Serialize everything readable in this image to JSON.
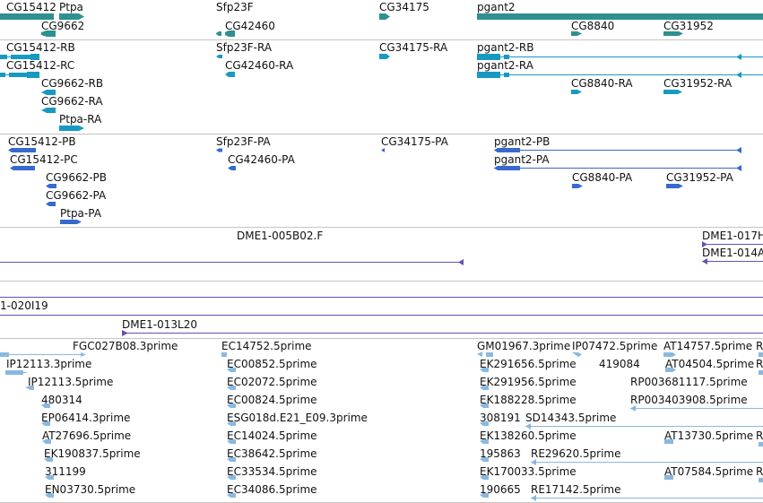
{
  "colors": {
    "gene": "#2e9091",
    "transcript": "#1899c1",
    "protein": "#3869cc",
    "clone": "#6a4fb0",
    "est": "#8ab8df",
    "separator": "#c4c4c4",
    "text": "#111111"
  },
  "tracks": {
    "genes": {
      "items": [
        {
          "label": "CG15412"
        },
        {
          "label": "Ptpa"
        },
        {
          "label": "CG9662"
        },
        {
          "label": "Sfp23F"
        },
        {
          "label": "CG42460"
        },
        {
          "label": "CG34175"
        },
        {
          "label": "pgant2"
        },
        {
          "label": "CG8840"
        },
        {
          "label": "CG31952"
        }
      ]
    },
    "transcripts": {
      "items": [
        {
          "label": "CG15412-RB"
        },
        {
          "label": "CG15412-RC"
        },
        {
          "label": "CG9662-RB"
        },
        {
          "label": "CG9662-RA"
        },
        {
          "label": "Ptpa-RA"
        },
        {
          "label": "Sfp23F-RA"
        },
        {
          "label": "CG42460-RA"
        },
        {
          "label": "CG34175-RA"
        },
        {
          "label": "pgant2-RB"
        },
        {
          "label": "pgant2-RA"
        },
        {
          "label": "CG8840-RA"
        },
        {
          "label": "CG31952-RA"
        }
      ]
    },
    "proteins": {
      "items": [
        {
          "label": "CG15412-PB"
        },
        {
          "label": "CG15412-PC"
        },
        {
          "label": "CG9662-PB"
        },
        {
          "label": "CG9662-PA"
        },
        {
          "label": "Ptpa-PA"
        },
        {
          "label": "Sfp23F-PA"
        },
        {
          "label": "CG42460-PA"
        },
        {
          "label": "CG34175-PA"
        },
        {
          "label": "pgant2-PB"
        },
        {
          "label": "pgant2-PA"
        },
        {
          "label": "CG8840-PA"
        },
        {
          "label": "CG31952-PA"
        }
      ]
    },
    "clones_a": {
      "items": [
        {
          "label": "DME1-005B02.F"
        },
        {
          "label": "DME1-017H"
        },
        {
          "label": "DME1-014A"
        }
      ]
    },
    "clones_b": {
      "items": [
        {
          "label": "1-020I19"
        },
        {
          "label": "DME1-013L20"
        }
      ]
    },
    "ests": {
      "items": [
        {
          "label": "FGC027B08.3prime"
        },
        {
          "label": "IP12113.3prime"
        },
        {
          "label": "IP12113.5prime"
        },
        {
          "label": "480314"
        },
        {
          "label": "EP06414.3prime"
        },
        {
          "label": "AT27696.5prime"
        },
        {
          "label": "EK190837.5prime"
        },
        {
          "label": "311199"
        },
        {
          "label": "EN03730.5prime"
        },
        {
          "label": "EC14752.5prime"
        },
        {
          "label": "EC00852.5prime"
        },
        {
          "label": "EC02072.5prime"
        },
        {
          "label": "EC00824.5prime"
        },
        {
          "label": "ESG018d.E21_E09.3prime"
        },
        {
          "label": "EC14024.5prime"
        },
        {
          "label": "EC38642.5prime"
        },
        {
          "label": "EC33534.5prime"
        },
        {
          "label": "EC34086.5prime"
        },
        {
          "label": "GM01967.3prime"
        },
        {
          "label": "IP07472.5prime"
        },
        {
          "label": "AT14757.5prime"
        },
        {
          "label": "R"
        },
        {
          "label": "EK291656.5prime"
        },
        {
          "label": "419084"
        },
        {
          "label": "AT04504.5prime"
        },
        {
          "label": "R"
        },
        {
          "label": "EK291956.5prime"
        },
        {
          "label": "RP003681117.5prime"
        },
        {
          "label": "EK188228.5prime"
        },
        {
          "label": "RP003403908.5prime"
        },
        {
          "label": "308191"
        },
        {
          "label": "SD14343.5prime"
        },
        {
          "label": "EK138260.5prime"
        },
        {
          "label": "AT13730.5prime"
        },
        {
          "label": "R"
        },
        {
          "label": "195863"
        },
        {
          "label": "RE29620.5prime"
        },
        {
          "label": "EK170033.5prime"
        },
        {
          "label": "AT07584.5prime"
        },
        {
          "label": "R"
        },
        {
          "label": "190665"
        },
        {
          "label": "RE17142.5prime"
        }
      ]
    }
  }
}
